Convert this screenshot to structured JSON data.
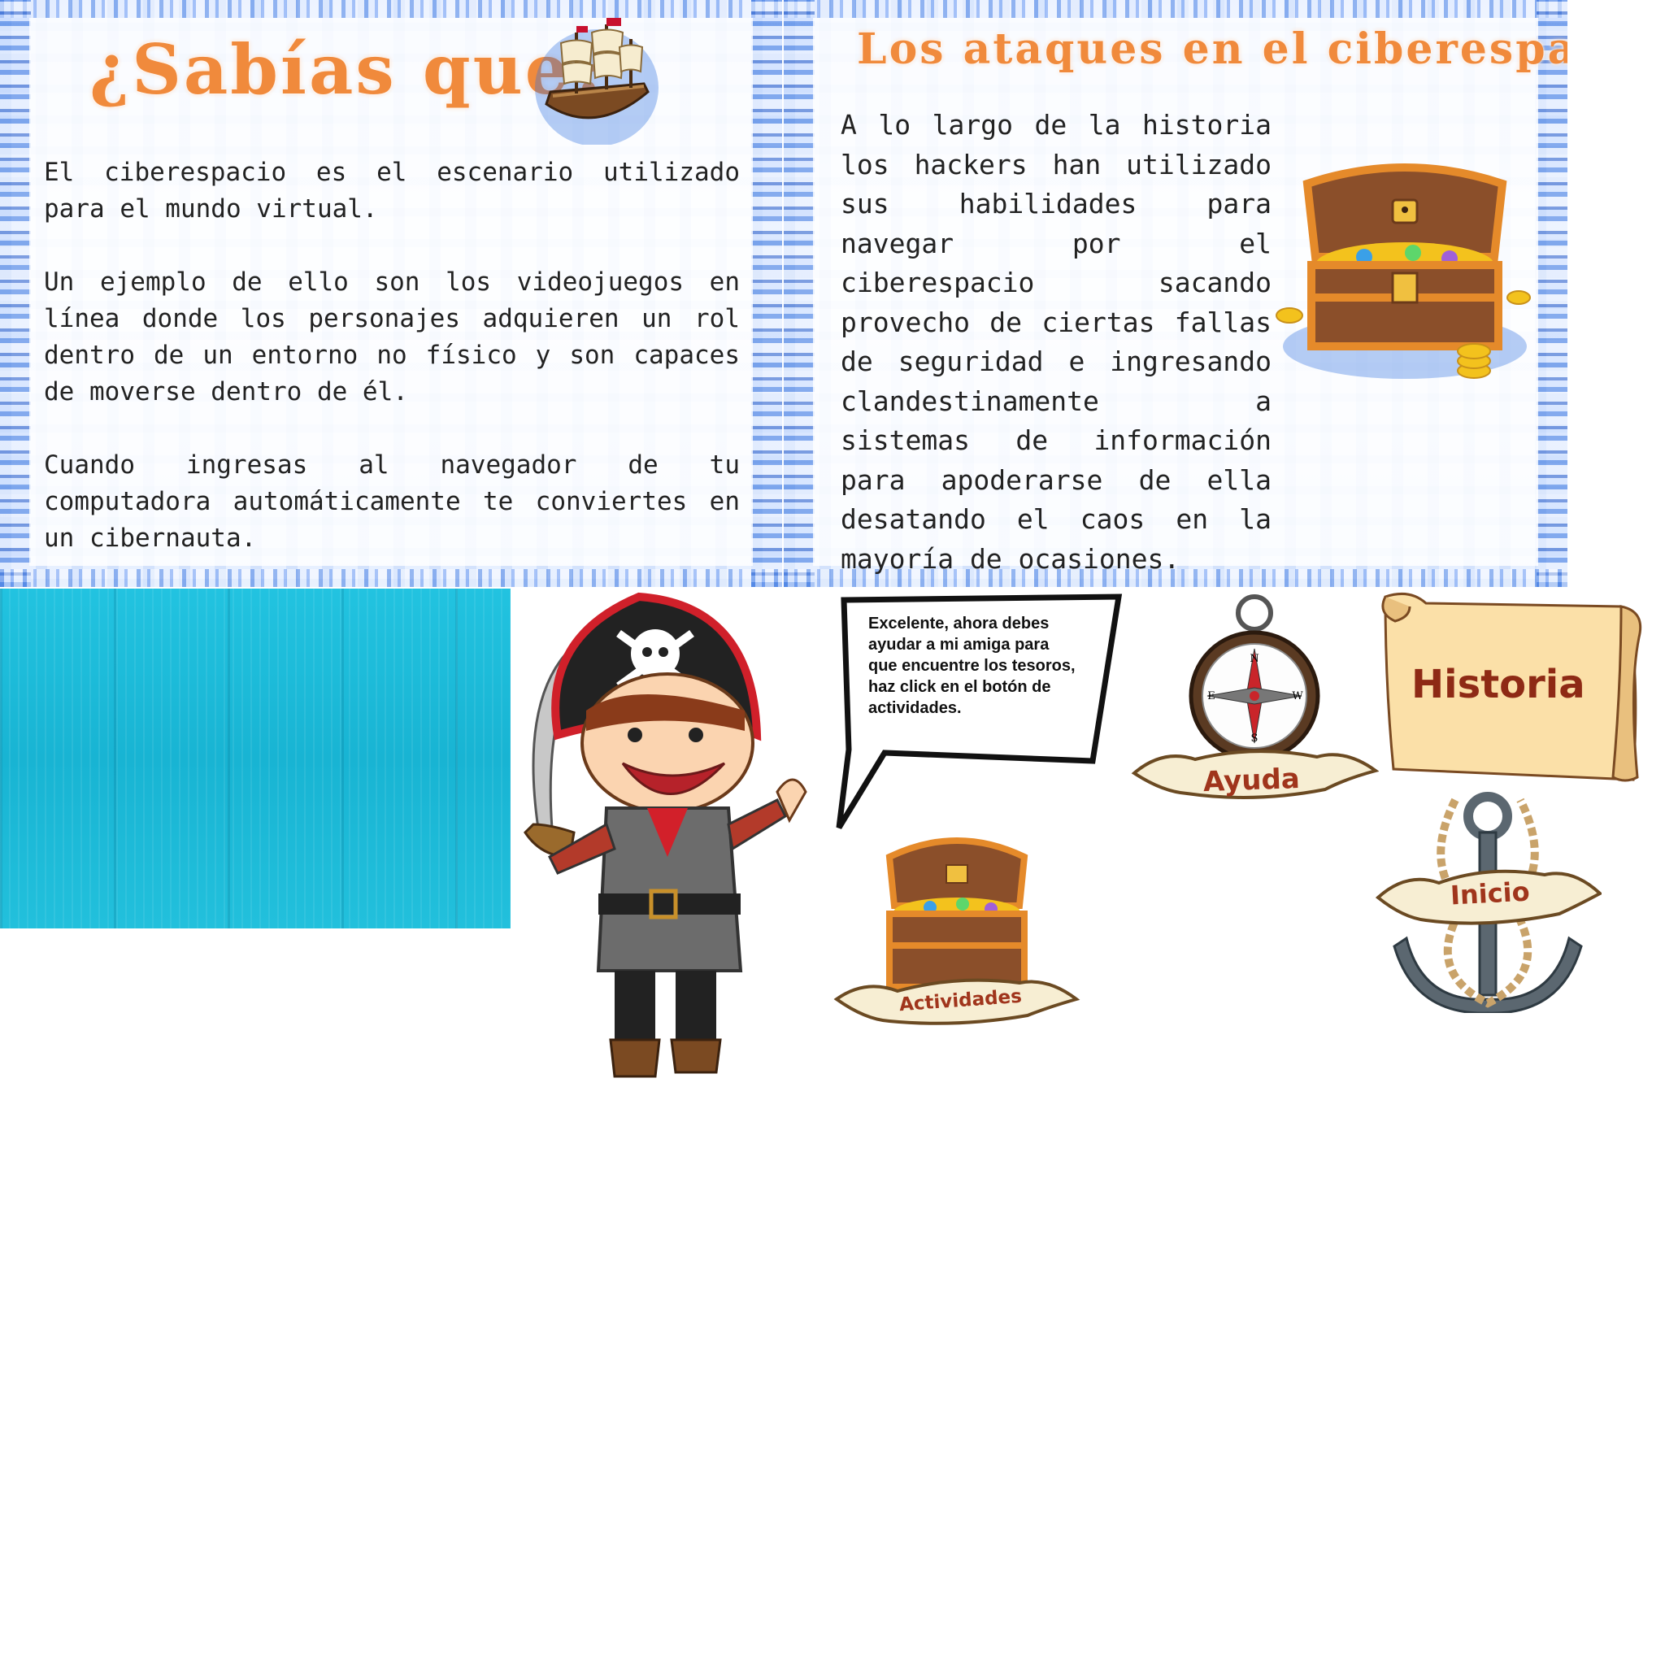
{
  "panel_left": {
    "title": "¿Sabías que?",
    "paragraphs": [
      "El ciberespacio es el escenario utilizado para el mundo virtual.",
      "Un ejemplo de ello son los videojuegos en línea donde los personajes adquieren un rol  dentro de un entorno no físico y son capaces de moverse dentro de él.",
      "Cuando ingresas al navegador de tu computadora automáticamente te conviertes en un cibernauta."
    ]
  },
  "panel_right": {
    "title": "Los ataques en el ciberespacio",
    "paragraph": "A lo largo de la historia los hackers han utilizado sus habilidades para navegar por el ciberespacio sacando provecho de ciertas fallas de seguridad e ingresando clandestinamente  a sistemas de información para apoderarse de ella desatando el caos en la mayoría de ocasiones."
  },
  "speech_bubble": {
    "text": "Excelente, ahora debes ayudar a mi amiga para que encuentre los tesoros, haz click en el botón de actividades."
  },
  "buttons": {
    "historia": "Historia",
    "ayuda": "Ayuda",
    "actividades": "Actividades",
    "inicio": "Inicio"
  },
  "compass": {
    "n": "N",
    "s": "S",
    "e": "E",
    "w": "W"
  },
  "icons": {
    "ship": "ship-icon",
    "treasure": "treasure-chest-icon",
    "pirate": "pirate-boy-icon",
    "compass": "compass-icon",
    "anchor": "anchor-icon",
    "scroll": "scroll-icon"
  },
  "colors": {
    "title_orange": "#f08a3c",
    "button_text": "#a0351c",
    "wood_cyan": "#1fbcd9"
  }
}
